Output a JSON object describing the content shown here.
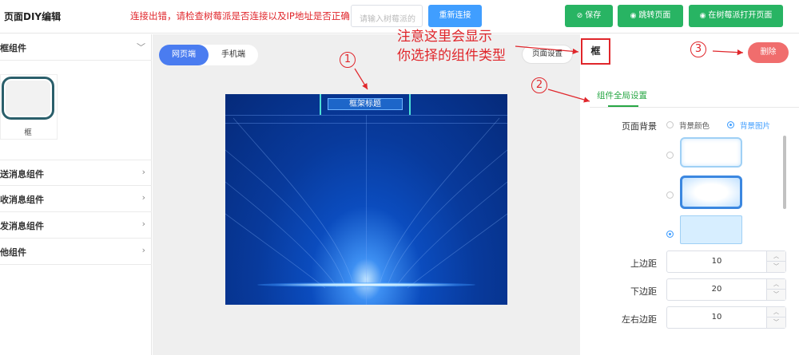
{
  "header": {
    "title": "页面DIY编辑",
    "error_message": "连接出错，请检查树莓派是否连接以及IP地址是否正确!",
    "pi_input_placeholder": "请输入树莓派的",
    "reconnect_label": "重新连接",
    "save_label": "保存",
    "jump_label": "跳转页面",
    "open_on_pi_label": "在树莓派打开页面"
  },
  "sidebar": {
    "categories": [
      {
        "label": "框组件",
        "expanded": true
      },
      {
        "label": "发送消息组件",
        "expanded": false
      },
      {
        "label": "接收消息组件",
        "expanded": false
      },
      {
        "label": "收发消息组件",
        "expanded": false
      },
      {
        "label": "他组件",
        "expanded": false
      }
    ],
    "component_label": "框"
  },
  "canvas": {
    "view_tabs": [
      "网页端",
      "手机端"
    ],
    "active_tab": "网页端",
    "preview_title": "框架标题"
  },
  "annotations": {
    "note_line1": "注意这里会显示",
    "note_line2": "你选择的组件类型",
    "marker1": "1",
    "marker2": "2",
    "marker3": "3"
  },
  "panel": {
    "page_settings_label": "页面设置",
    "component_type": "框",
    "delete_label": "删除",
    "global_tab": "组件全局设置",
    "page_bg_label": "页面背景",
    "bg_color_option": "背景颜色",
    "bg_image_option": "背景图片",
    "bg_mode": "背景图片",
    "selected_bg_index": 2,
    "top_margin_label": "上边距",
    "top_margin": "10",
    "bottom_margin_label": "下边距",
    "bottom_margin": "20",
    "side_margin_label": "左右边距",
    "side_margin": "10"
  },
  "colors": {
    "primary": "#409eff",
    "success": "#28b463",
    "danger": "#f06d6d",
    "annotation": "#e0262b"
  }
}
